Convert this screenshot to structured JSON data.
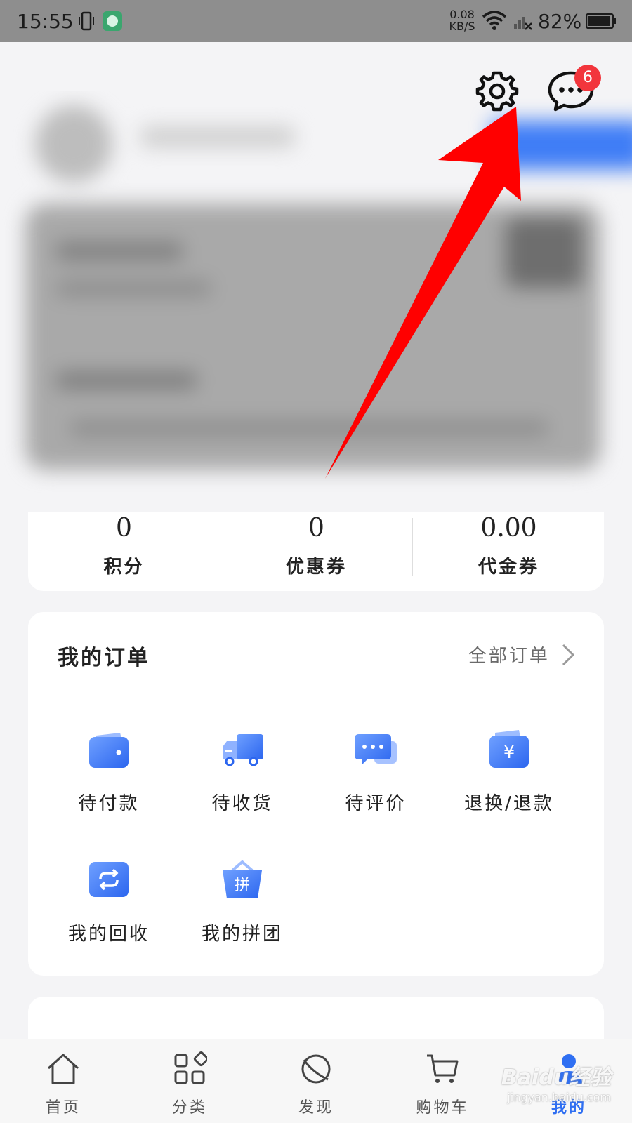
{
  "status_bar": {
    "time": "15:55",
    "net_speed_value": "0.08",
    "net_speed_unit": "KB/S",
    "battery": "82%"
  },
  "header": {
    "message_badge_count": "6"
  },
  "stats": [
    {
      "value": "0",
      "label": "积分"
    },
    {
      "value": "0",
      "label": "优惠券"
    },
    {
      "value": "0.00",
      "label": "代金券"
    }
  ],
  "orders": {
    "title": "我的订单",
    "all_orders_label": "全部订单",
    "items": [
      {
        "label": "待付款",
        "icon": "wallet-icon"
      },
      {
        "label": "待收货",
        "icon": "truck-icon"
      },
      {
        "label": "待评价",
        "icon": "chat-bubbles-icon"
      },
      {
        "label": "退换/退款",
        "icon": "refund-yen-icon"
      },
      {
        "label": "我的回收",
        "icon": "recycle-icon"
      },
      {
        "label": "我的拼团",
        "icon": "group-buy-basket-icon",
        "icon_text": "拼"
      }
    ]
  },
  "tabbar": {
    "items": [
      {
        "label": "首页",
        "icon": "home-icon"
      },
      {
        "label": "分类",
        "icon": "category-icon"
      },
      {
        "label": "发现",
        "icon": "discover-icon"
      },
      {
        "label": "购物车",
        "icon": "cart-icon"
      },
      {
        "label": "我的",
        "icon": "profile-icon",
        "active": true
      }
    ]
  },
  "watermark": {
    "main": "Baidu经验",
    "sub": "jingyan.baidu.com"
  },
  "colors": {
    "accent_blue": "#2f6ff2",
    "badge_red": "#f2353c",
    "annotation_red": "#ff0000"
  }
}
